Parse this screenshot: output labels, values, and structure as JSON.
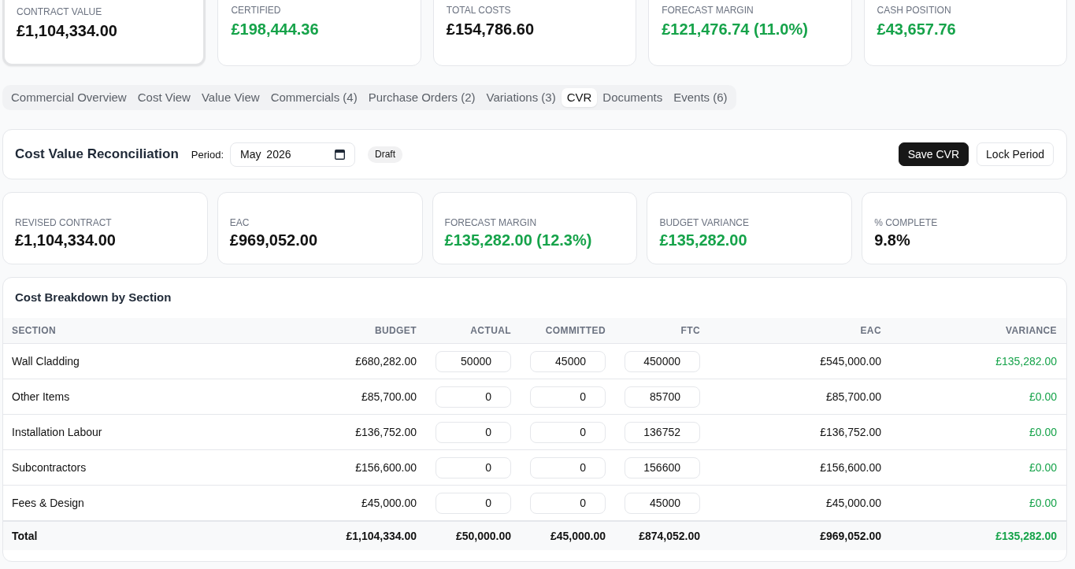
{
  "summary_cards": [
    {
      "label": "CONTRACT VALUE",
      "value": "£1,104,334.00",
      "positive": false,
      "selected": true
    },
    {
      "label": "CERTIFIED",
      "value": "£198,444.36",
      "positive": true,
      "selected": false
    },
    {
      "label": "TOTAL COSTS",
      "value": "£154,786.60",
      "positive": false,
      "selected": false
    },
    {
      "label": "FORECAST MARGIN",
      "value": "£121,476.74 (11.0%)",
      "positive": true,
      "selected": false
    },
    {
      "label": "CASH POSITION",
      "value": "£43,657.76",
      "positive": true,
      "selected": false
    }
  ],
  "tabs": [
    {
      "label": "Commercial Overview",
      "selected": false
    },
    {
      "label": "Cost View",
      "selected": false
    },
    {
      "label": "Value View",
      "selected": false
    },
    {
      "label": "Commercials (4)",
      "selected": false
    },
    {
      "label": "Purchase Orders (2)",
      "selected": false
    },
    {
      "label": "Variations (3)",
      "selected": false
    },
    {
      "label": "CVR",
      "selected": true
    },
    {
      "label": "Documents",
      "selected": false
    },
    {
      "label": "Events (6)",
      "selected": false
    }
  ],
  "cvr_header": {
    "title": "Cost Value Reconciliation",
    "period_label": "Period:",
    "period_value": "May 2026",
    "status_badge": "Draft",
    "buttons": [
      {
        "label": "Save CVR",
        "kind": "primary"
      },
      {
        "label": "Lock Period",
        "kind": "secondary"
      }
    ]
  },
  "metrics": [
    {
      "label": "REVISED CONTRACT",
      "value": "£1,104,334.00",
      "positive": false
    },
    {
      "label": "EAC",
      "value": "£969,052.00",
      "positive": false
    },
    {
      "label": "FORECAST MARGIN",
      "value": "£135,282.00 (12.3%)",
      "positive": true
    },
    {
      "label": "BUDGET VARIANCE",
      "value": "£135,282.00",
      "positive": true
    },
    {
      "label": "% COMPLETE",
      "value": "9.8%",
      "positive": false
    }
  ],
  "breakdown": {
    "title": "Cost Breakdown by Section",
    "columns": [
      {
        "label": "SECTION",
        "kind": "text"
      },
      {
        "label": "BUDGET",
        "kind": "amount"
      },
      {
        "label": "ACTUAL",
        "kind": "input"
      },
      {
        "label": "COMMITTED",
        "kind": "input"
      },
      {
        "label": "FTC",
        "kind": "input"
      },
      {
        "label": "EAC",
        "kind": "amount"
      },
      {
        "label": "VARIANCE",
        "kind": "variance"
      }
    ],
    "rows": [
      {
        "cells": [
          "Wall Cladding",
          "£680,282.00",
          "50000",
          "45000",
          "450000",
          "£545,000.00",
          "£135,282.00"
        ]
      },
      {
        "cells": [
          "Other Items",
          "£85,700.00",
          "0",
          "0",
          "85700",
          "£85,700.00",
          "£0.00"
        ]
      },
      {
        "cells": [
          "Installation Labour",
          "£136,752.00",
          "0",
          "0",
          "136752",
          "£136,752.00",
          "£0.00"
        ]
      },
      {
        "cells": [
          "Subcontractors",
          "£156,600.00",
          "0",
          "0",
          "156600",
          "£156,600.00",
          "£0.00"
        ]
      },
      {
        "cells": [
          "Fees & Design",
          "£45,000.00",
          "0",
          "0",
          "45000",
          "£45,000.00",
          "£0.00"
        ]
      }
    ],
    "total": {
      "cells": [
        "Total",
        "£1,104,334.00",
        "£50,000.00",
        "£45,000.00",
        "£874,052.00",
        "£969,052.00",
        "£135,282.00"
      ]
    }
  }
}
